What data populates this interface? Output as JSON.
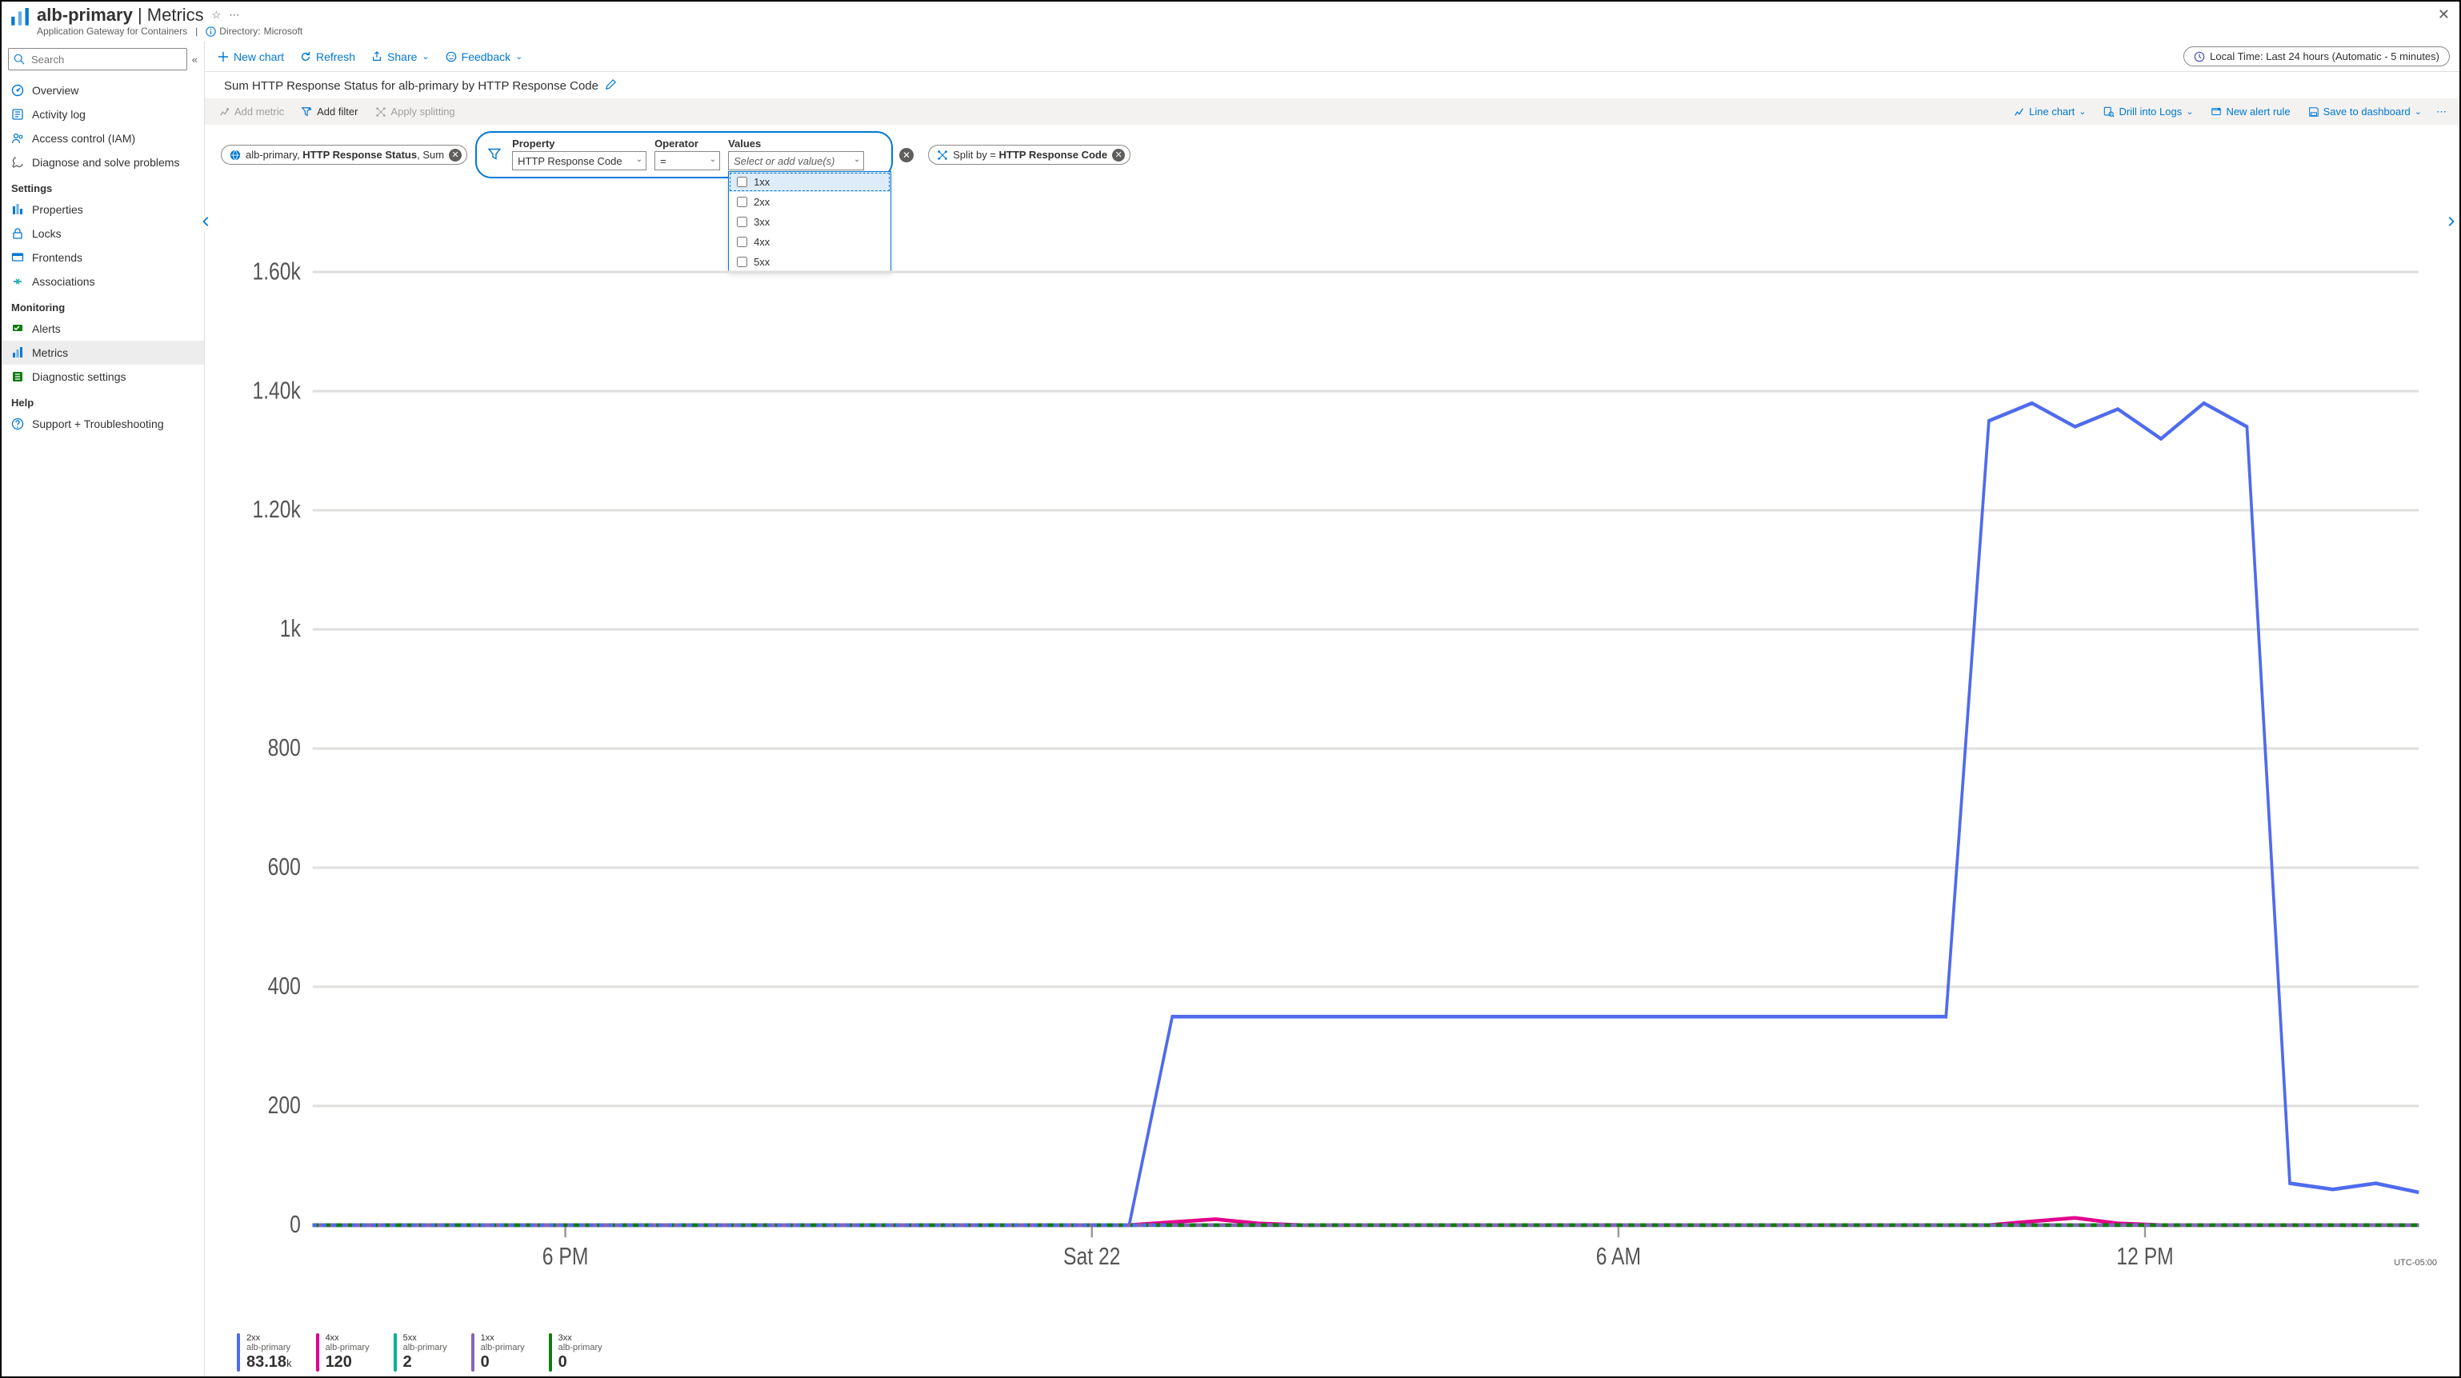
{
  "header": {
    "resource": "alb-primary",
    "section": "Metrics",
    "subtitle": "Application Gateway for Containers",
    "directory_label": "Directory:",
    "directory_value": "Microsoft"
  },
  "search": {
    "placeholder": "Search"
  },
  "nav": {
    "items_top": [
      {
        "key": "overview",
        "label": "Overview"
      },
      {
        "key": "activity",
        "label": "Activity log"
      },
      {
        "key": "iam",
        "label": "Access control (IAM)"
      },
      {
        "key": "diag",
        "label": "Diagnose and solve problems"
      }
    ],
    "group_settings": "Settings",
    "items_settings": [
      {
        "key": "properties",
        "label": "Properties"
      },
      {
        "key": "locks",
        "label": "Locks"
      },
      {
        "key": "frontends",
        "label": "Frontends"
      },
      {
        "key": "associations",
        "label": "Associations"
      }
    ],
    "group_monitoring": "Monitoring",
    "items_monitoring": [
      {
        "key": "alerts",
        "label": "Alerts"
      },
      {
        "key": "metrics",
        "label": "Metrics"
      },
      {
        "key": "diagset",
        "label": "Diagnostic settings"
      }
    ],
    "group_help": "Help",
    "items_help": [
      {
        "key": "support",
        "label": "Support + Troubleshooting"
      }
    ]
  },
  "toolbar": {
    "new_chart": "New chart",
    "refresh": "Refresh",
    "share": "Share",
    "feedback": "Feedback",
    "time_range": "Local Time: Last 24 hours (Automatic - 5 minutes)"
  },
  "chart_title": "Sum HTTP Response Status for alb-primary by HTTP Response Code",
  "toolbar2": {
    "add_metric": "Add metric",
    "add_filter": "Add filter",
    "apply_splitting": "Apply splitting",
    "line_chart": "Line chart",
    "drill_logs": "Drill into Logs",
    "new_alert": "New alert rule",
    "save_dash": "Save to dashboard"
  },
  "metric_pill": {
    "resource": "alb-primary",
    "metric": "HTTP Response Status",
    "agg": "Sum"
  },
  "filter": {
    "property_label": "Property",
    "property_value": "HTTP Response Code",
    "operator_label": "Operator",
    "operator_value": "=",
    "values_label": "Values",
    "values_placeholder": "Select or add value(s)",
    "options": [
      "1xx",
      "2xx",
      "3xx",
      "4xx",
      "5xx"
    ]
  },
  "split_pill": {
    "prefix": "Split by = ",
    "value": "HTTP Response Code"
  },
  "chart_data": {
    "type": "line",
    "ylim": [
      0,
      1700
    ],
    "yticks": [
      "1.60k",
      "1.40k",
      "1.20k",
      "1k",
      "800",
      "600",
      "400",
      "200",
      "0"
    ],
    "xticks": [
      "6 PM",
      "Sat 22",
      "6 AM",
      "12 PM"
    ],
    "utc": "UTC-05:00",
    "x": [
      0,
      1,
      2,
      3,
      4,
      5,
      6,
      7,
      8,
      9,
      10,
      11,
      12,
      13,
      14,
      15,
      16,
      17,
      18,
      19,
      20,
      21,
      22,
      23,
      24,
      25,
      26,
      27,
      28,
      29,
      30,
      31,
      32,
      33,
      34,
      35,
      36,
      37,
      38,
      39,
      40,
      41,
      42,
      43,
      44,
      45,
      46,
      47,
      48,
      49
    ],
    "series": [
      {
        "name": "2xx",
        "color": "#4f6bed",
        "values": [
          0,
          0,
          0,
          0,
          0,
          0,
          0,
          0,
          0,
          0,
          0,
          0,
          0,
          0,
          0,
          0,
          0,
          0,
          0,
          0,
          350,
          350,
          350,
          350,
          350,
          350,
          350,
          350,
          350,
          350,
          350,
          350,
          350,
          350,
          350,
          350,
          350,
          350,
          350,
          1350,
          1380,
          1340,
          1370,
          1320,
          1380,
          1340,
          70,
          60,
          70,
          55
        ]
      },
      {
        "name": "4xx",
        "color": "#e3008c",
        "values": [
          0,
          0,
          0,
          0,
          0,
          0,
          0,
          0,
          0,
          0,
          0,
          0,
          0,
          0,
          0,
          0,
          0,
          0,
          0,
          0,
          5,
          10,
          3,
          0,
          0,
          0,
          0,
          0,
          0,
          0,
          0,
          0,
          0,
          0,
          0,
          0,
          0,
          0,
          0,
          0,
          6,
          12,
          3,
          0,
          0,
          0,
          0,
          0,
          0,
          0
        ]
      },
      {
        "name": "5xx",
        "color": "#00b294",
        "values": [
          0,
          0,
          0,
          0,
          0,
          0,
          0,
          0,
          0,
          0,
          0,
          0,
          0,
          0,
          0,
          0,
          0,
          0,
          0,
          0,
          0,
          0,
          0,
          0,
          0,
          0,
          0,
          0,
          0,
          0,
          0,
          0,
          0,
          0,
          0,
          0,
          0,
          0,
          0,
          0,
          0,
          0,
          0,
          0,
          0,
          0,
          0,
          0,
          0,
          0
        ]
      },
      {
        "name": "1xx",
        "color": "#8764b8",
        "values": [
          0,
          0,
          0,
          0,
          0,
          0,
          0,
          0,
          0,
          0,
          0,
          0,
          0,
          0,
          0,
          0,
          0,
          0,
          0,
          0,
          0,
          0,
          0,
          0,
          0,
          0,
          0,
          0,
          0,
          0,
          0,
          0,
          0,
          0,
          0,
          0,
          0,
          0,
          0,
          0,
          0,
          0,
          0,
          0,
          0,
          0,
          0,
          0,
          0,
          0
        ]
      },
      {
        "name": "3xx",
        "color": "#107c10",
        "values": [
          0,
          0,
          0,
          0,
          0,
          0,
          0,
          0,
          0,
          0,
          0,
          0,
          0,
          0,
          0,
          0,
          0,
          0,
          0,
          0,
          0,
          0,
          0,
          0,
          0,
          0,
          0,
          0,
          0,
          0,
          0,
          0,
          0,
          0,
          0,
          0,
          0,
          0,
          0,
          0,
          0,
          0,
          0,
          0,
          0,
          0,
          0,
          0,
          0,
          0
        ]
      }
    ]
  },
  "legend": [
    {
      "series": "2xx",
      "resource": "alb-primary",
      "value": "83.18",
      "unit": "k",
      "color": "#4f6bed"
    },
    {
      "series": "4xx",
      "resource": "alb-primary",
      "value": "120",
      "unit": "",
      "color": "#e3008c"
    },
    {
      "series": "5xx",
      "resource": "alb-primary",
      "value": "2",
      "unit": "",
      "color": "#00b294"
    },
    {
      "series": "1xx",
      "resource": "alb-primary",
      "value": "0",
      "unit": "",
      "color": "#8764b8"
    },
    {
      "series": "3xx",
      "resource": "alb-primary",
      "value": "0",
      "unit": "",
      "color": "#107c10"
    }
  ]
}
